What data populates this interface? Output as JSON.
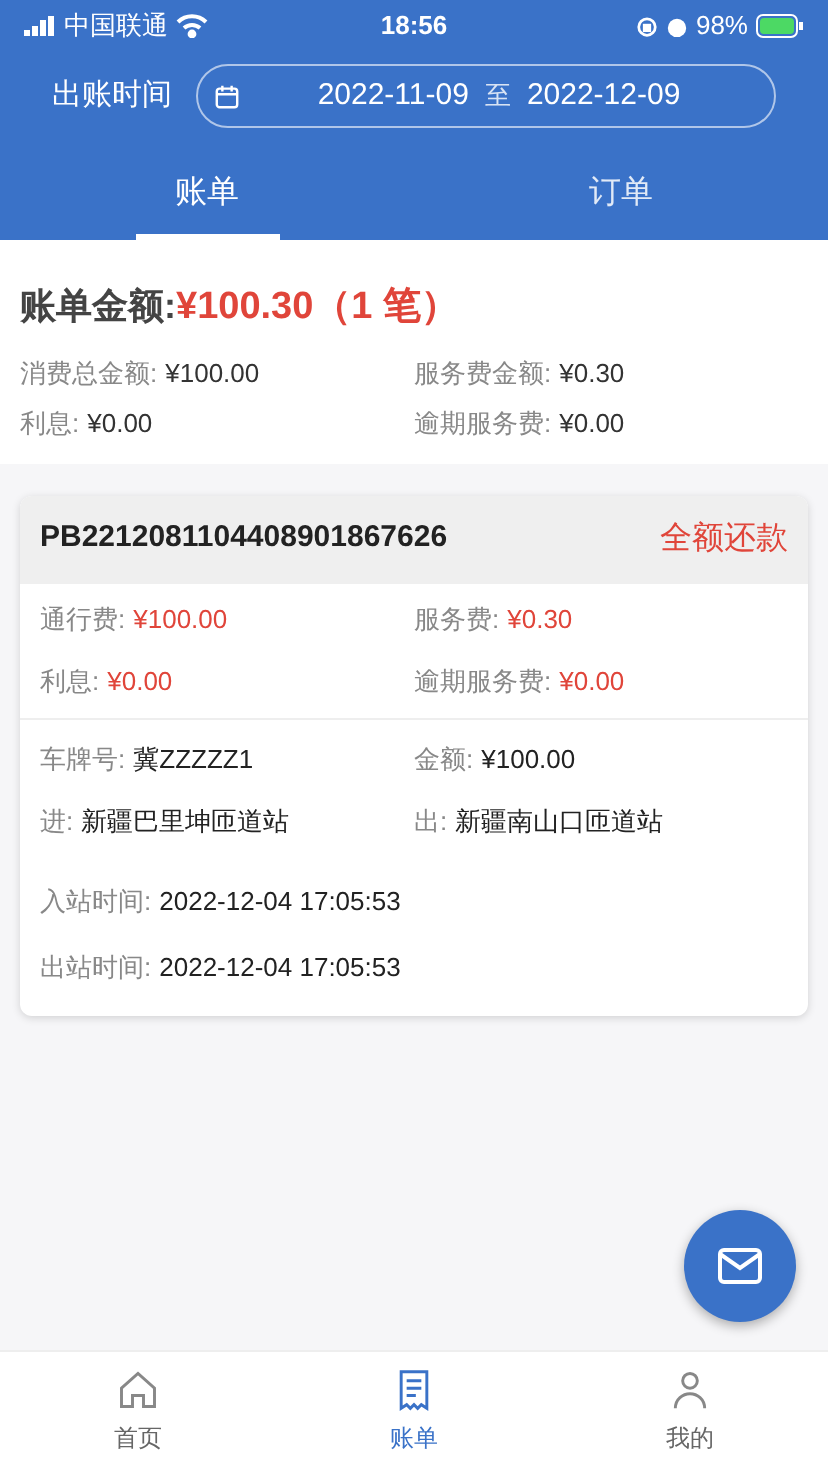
{
  "status_bar": {
    "carrier": "中国联通",
    "time": "18:56",
    "battery": "98%"
  },
  "filter": {
    "label": "出账时间",
    "start": "2022-11-09",
    "separator": "至",
    "end": "2022-12-09"
  },
  "tabs": [
    {
      "label": "账单",
      "selected": true
    },
    {
      "label": "订单",
      "selected": false
    }
  ],
  "summary": {
    "title": "账单金额:",
    "amount": "¥100.30（1 笔）",
    "fields": [
      {
        "label": "消费总金额:",
        "value": "¥100.00"
      },
      {
        "label": "服务费金额:",
        "value": "¥0.30"
      },
      {
        "label": "利息:",
        "value": "¥0.00"
      },
      {
        "label": "逾期服务费:",
        "value": "¥0.00"
      }
    ]
  },
  "bills": [
    {
      "number": "PB2212081104408901867626",
      "action": "全额还款",
      "fees": [
        {
          "label": "通行费:",
          "value": "¥100.00"
        },
        {
          "label": "服务费:",
          "value": "¥0.30"
        },
        {
          "label": "利息:",
          "value": "¥0.00"
        },
        {
          "label": "逾期服务费:",
          "value": "¥0.00"
        }
      ],
      "details": [
        {
          "label": "车牌号:",
          "value": "冀ZZZZZ1"
        },
        {
          "label": "金额:",
          "value": "¥100.00"
        },
        {
          "label": "进:",
          "value": "新疆巴里坤匝道站"
        },
        {
          "label": "出:",
          "value": "新疆南山口匝道站"
        }
      ],
      "times": [
        {
          "label": "入站时间:",
          "value": "2022-12-04 17:05:53"
        },
        {
          "label": "出站时间:",
          "value": "2022-12-04 17:05:53"
        }
      ]
    }
  ],
  "nav": [
    {
      "label": "首页",
      "kind": "home",
      "selected": false
    },
    {
      "label": "账单",
      "kind": "bill",
      "selected": true
    },
    {
      "label": "我的",
      "kind": "user",
      "selected": false
    }
  ]
}
